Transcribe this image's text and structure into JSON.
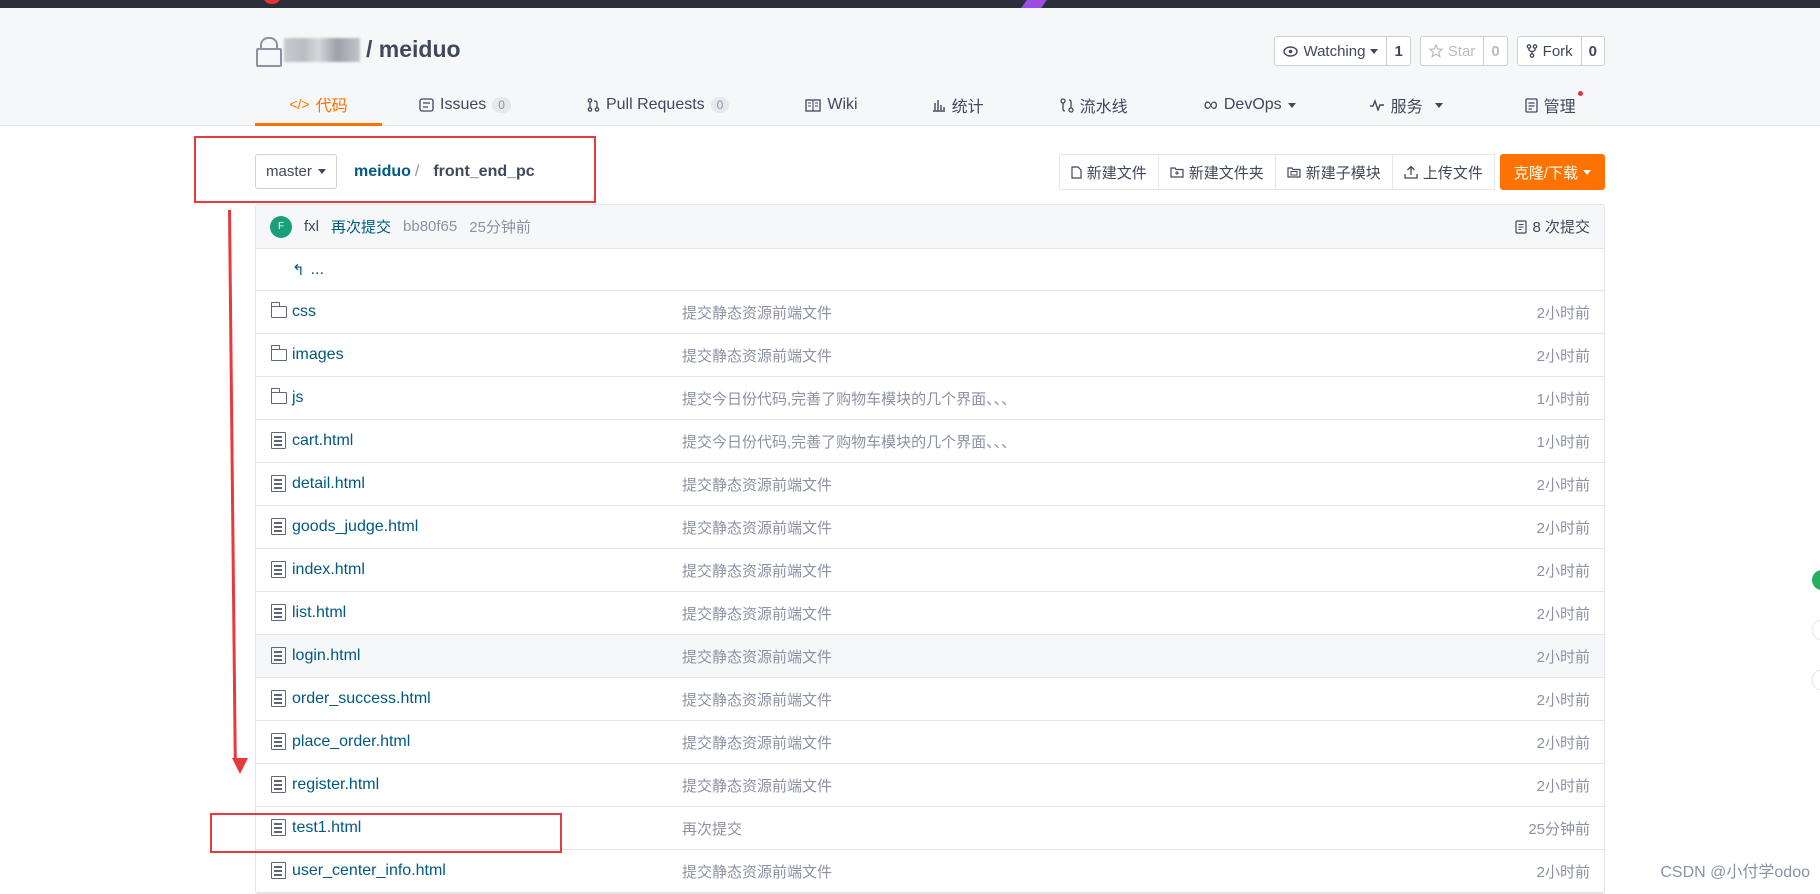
{
  "repo": {
    "name": "/ meiduo",
    "watch": {
      "label": "Watching",
      "count": "1"
    },
    "star": {
      "label": "Star",
      "count": "0"
    },
    "fork": {
      "label": "Fork",
      "count": "0"
    }
  },
  "tabs": [
    {
      "label": "代码",
      "icon": "code-icon",
      "active": true
    },
    {
      "label": "Issues",
      "icon": "issues-icon",
      "count": "0"
    },
    {
      "label": "Pull Requests",
      "icon": "pull-request-icon",
      "count": "0"
    },
    {
      "label": "Wiki",
      "icon": "book-icon"
    },
    {
      "label": "统计",
      "icon": "bar-chart-icon"
    },
    {
      "label": "流水线",
      "icon": "pipeline-icon"
    },
    {
      "label": "DevOps",
      "icon": "infinity-icon"
    },
    {
      "label": "服务",
      "icon": "pulse-icon"
    },
    {
      "label": "管理",
      "icon": "settings-doc-icon"
    }
  ],
  "toolbar": {
    "branch": "master",
    "crumb_root": "meiduo",
    "crumb_sep": "/",
    "crumb_current": "front_end_pc",
    "new_file": "新建文件",
    "new_folder": "新建文件夹",
    "new_submodule": "新建子模块",
    "upload": "上传文件",
    "clone": "克隆/下载"
  },
  "commit": {
    "avatar_letter": "F",
    "author": "fxl",
    "message": "再次提交",
    "sha": "bb80f65",
    "time": "25分钟前",
    "total": "8 次提交"
  },
  "up_dir": "...",
  "files": [
    {
      "name": "css",
      "type": "folder",
      "msg": "提交静态资源前端文件",
      "time": "2小时前"
    },
    {
      "name": "images",
      "type": "folder",
      "msg": "提交静态资源前端文件",
      "time": "2小时前"
    },
    {
      "name": "js",
      "type": "folder",
      "msg": "提交今日份代码,完善了购物车模块的几个界面、、、",
      "time": "1小时前"
    },
    {
      "name": "cart.html",
      "type": "file",
      "msg": "提交今日份代码,完善了购物车模块的几个界面、、、",
      "time": "1小时前"
    },
    {
      "name": "detail.html",
      "type": "file",
      "msg": "提交静态资源前端文件",
      "time": "2小时前"
    },
    {
      "name": "goods_judge.html",
      "type": "file",
      "msg": "提交静态资源前端文件",
      "time": "2小时前"
    },
    {
      "name": "index.html",
      "type": "file",
      "msg": "提交静态资源前端文件",
      "time": "2小时前"
    },
    {
      "name": "list.html",
      "type": "file",
      "msg": "提交静态资源前端文件",
      "time": "2小时前"
    },
    {
      "name": "login.html",
      "type": "file",
      "msg": "提交静态资源前端文件",
      "time": "2小时前"
    },
    {
      "name": "order_success.html",
      "type": "file",
      "msg": "提交静态资源前端文件",
      "time": "2小时前"
    },
    {
      "name": "place_order.html",
      "type": "file",
      "msg": "提交静态资源前端文件",
      "time": "2小时前"
    },
    {
      "name": "register.html",
      "type": "file",
      "msg": "提交静态资源前端文件",
      "time": "2小时前"
    },
    {
      "name": "test1.html",
      "type": "file",
      "msg": "再次提交",
      "time": "25分钟前"
    },
    {
      "name": "user_center_info.html",
      "type": "file",
      "msg": "提交静态资源前端文件",
      "time": "2小时前"
    }
  ],
  "watermark": "CSDN @小付学odoo",
  "colors": {
    "accent": "#fe7300",
    "link": "#005980",
    "annotation": "#e8393d"
  }
}
